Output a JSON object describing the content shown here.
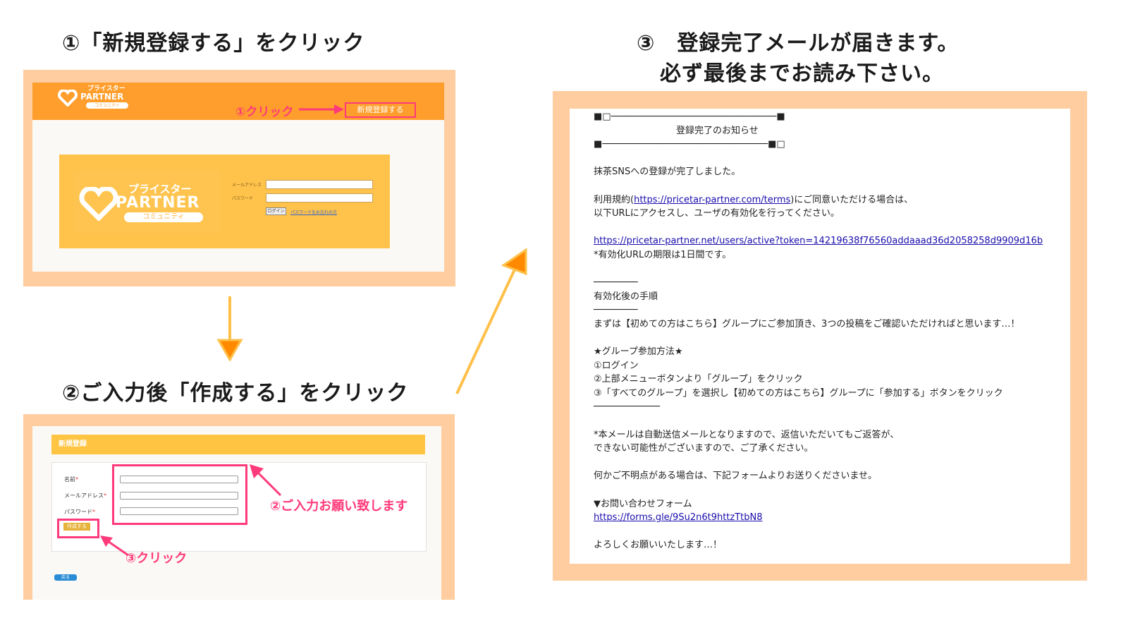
{
  "step1": {
    "heading": "①「新規登録する」をクリック",
    "logo_small": "プライスター",
    "logo_partner": "PARTNER",
    "logo_community": "コミュニティ",
    "new_register_button": "新規登録する",
    "click_annotation": "①クリック",
    "login": {
      "logo_top": "プライスター",
      "logo_main": "PARTNER",
      "logo_sub": "コミュニティ",
      "email_label": "メールアドレス",
      "password_label": "パスワード",
      "login_button": "ログイン",
      "forgot_link": "パスワードをお忘れの方"
    }
  },
  "step2": {
    "heading": "②ご入力後「作成する」をクリック",
    "bar_title": "新規登録",
    "name_label": "名前",
    "email_label": "メールアドレス",
    "password_label": "パスワード",
    "required_mark": "*",
    "create_button": "作成する",
    "back_button": "戻る",
    "input_annotation": "②ご入力お願い致します",
    "click_annotation": "③クリック"
  },
  "step3": {
    "heading_line1": "③　登録完了メールが届きます。",
    "heading_line2": "必ず最後までお読み下さい。",
    "email": {
      "border_top": "■□──────────────────────────────■",
      "notice_title": "登録完了のお知らせ",
      "border_bottom": "■──────────────────────────────■□",
      "completed": "抹茶SNSへの登録が完了しました。",
      "terms_prefix": "利用規約(",
      "terms_url": "https://pricetar-partner.com/terms",
      "terms_suffix": ")にご同意いただける場合は、",
      "access_line": "以下URLにアクセスし、ユーザの有効化を行ってください。",
      "activate_url": "https://pricetar-partner.net/users/active?token=14219638f76560addaaad36d2058258d9909d16b",
      "expiry": "*有効化URLの期限は1日間です。",
      "dash_short_1": "────────",
      "procedure_title": "有効化後の手順",
      "dash_short_2": "────────",
      "procedure_text": "まずは【初めての方はこちら】グループにご参加頂き、3つの投稿をご確認いただければと思います…！",
      "how_title": "★グループ参加方法★",
      "how_1": "①ログイン",
      "how_2": "②上部メニューボタンより「グループ」をクリック",
      "how_3": "③「すべてのグループ」を選択し【初めての方はこちら】グループに「参加する」ボタンをクリック",
      "dash_long": "────────────",
      "auto_1": "*本メールは自動送信メールとなりますので、返信いただいてもご返答が、",
      "auto_2": "できない可能性がございますので、ご了承ください。",
      "question": "何かご不明点がある場合は、下記フォームよりお送りくださいませ。",
      "form_title": "▼お問い合わせフォーム",
      "form_url": "https://forms.gle/9Su2n6t9httzTtbN8",
      "closing": "よろしくお願いいたします…！"
    }
  },
  "colors": {
    "frame": "#ffcda0",
    "header_orange": "#ff9e2c",
    "login_yellow": "#ffc24a",
    "annotation_pink": "#ff3a7a",
    "arrow_yellow": "#ffc04a",
    "arrow_orange": "#ff8a00"
  }
}
